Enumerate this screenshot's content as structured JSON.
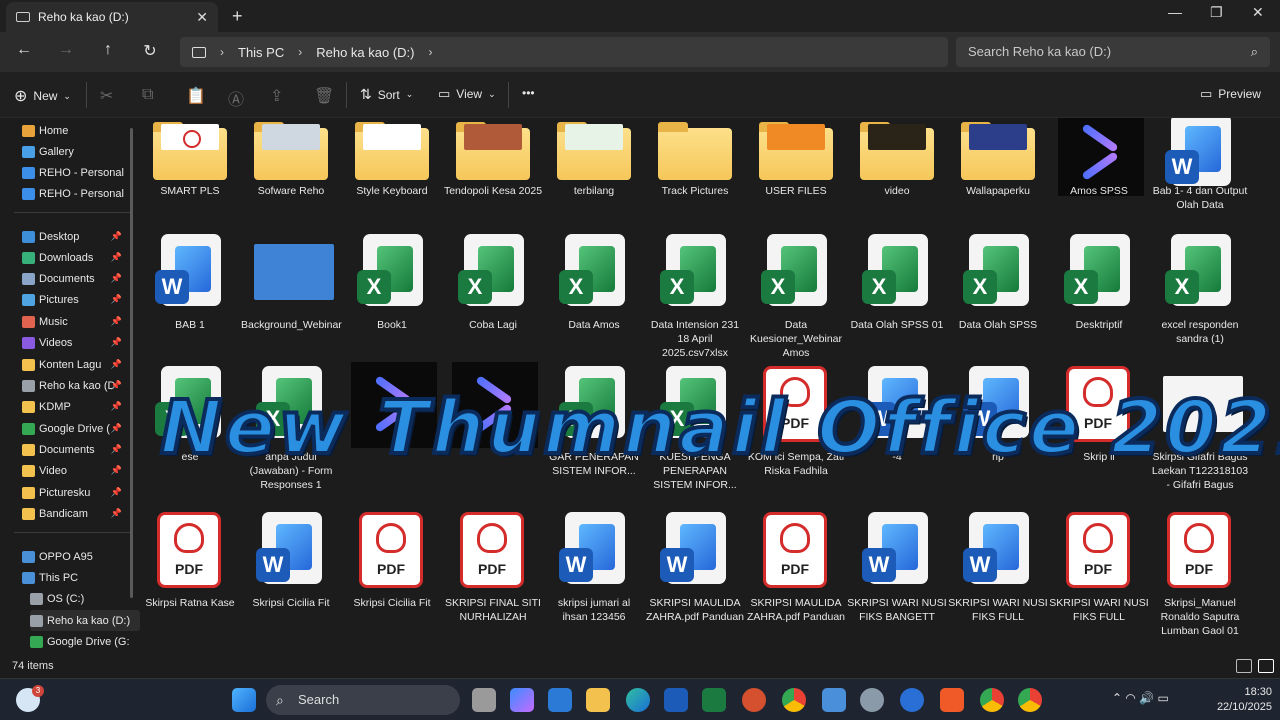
{
  "window": {
    "tab_title": "Reho ka kao (D:)",
    "new_tab": "+",
    "minimize": "—",
    "maximize": "❐",
    "close": "✕"
  },
  "nav": {
    "back": "←",
    "forward": "→",
    "up": "↑",
    "refresh": "↻",
    "breadcrumb": [
      "This PC",
      "Reho ka kao (D:)"
    ],
    "chevron": "›",
    "search_placeholder": "Search Reho ka kao (D:)"
  },
  "toolbar": {
    "new_label": "New",
    "sort_label": "Sort",
    "view_label": "View",
    "more": "•••",
    "preview_label": "Preview"
  },
  "sidebar": {
    "items": [
      {
        "label": "Home",
        "icon": "home-icon",
        "color": "#e8a33a",
        "pinned": false
      },
      {
        "label": "Gallery",
        "icon": "gallery-icon",
        "color": "#4aa0e6",
        "pinned": false
      },
      {
        "label": "REHO - Personal",
        "icon": "cloud-icon",
        "color": "#3b8fe8",
        "pinned": false
      },
      {
        "label": "REHO - Personal",
        "icon": "cloud-icon",
        "color": "#3b8fe8",
        "pinned": false
      },
      {
        "label": "Desktop",
        "icon": "desktop-icon",
        "color": "#3d8fd9",
        "pinned": true
      },
      {
        "label": "Downloads",
        "icon": "download-icon",
        "color": "#38b07a",
        "pinned": true
      },
      {
        "label": "Documents",
        "icon": "documents-icon",
        "color": "#8aa4c8",
        "pinned": true
      },
      {
        "label": "Pictures",
        "icon": "pictures-icon",
        "color": "#4fa3e0",
        "pinned": true
      },
      {
        "label": "Music",
        "icon": "music-icon",
        "color": "#e0634f",
        "pinned": true
      },
      {
        "label": "Videos",
        "icon": "videos-icon",
        "color": "#8a5be0",
        "pinned": true
      },
      {
        "label": "Konten Lagu",
        "icon": "folder-icon",
        "color": "#f2c14e",
        "pinned": true
      },
      {
        "label": "Reho ka kao (D",
        "icon": "drive-icon",
        "color": "#9aa0a8",
        "pinned": true
      },
      {
        "label": "KDMP",
        "icon": "folder-icon",
        "color": "#f2c14e",
        "pinned": true
      },
      {
        "label": "Google Drive (",
        "icon": "google-drive-icon",
        "color": "#34a853",
        "pinned": true
      },
      {
        "label": "Documents",
        "icon": "folder-icon",
        "color": "#f2c14e",
        "pinned": true
      },
      {
        "label": "Video",
        "icon": "folder-icon",
        "color": "#f2c14e",
        "pinned": true
      },
      {
        "label": "Picturesku",
        "icon": "folder-icon",
        "color": "#f2c14e",
        "pinned": true
      },
      {
        "label": "Bandicam",
        "icon": "folder-icon",
        "color": "#f2c14e",
        "pinned": true
      }
    ],
    "devices": [
      {
        "label": "OPPO A95",
        "icon": "phone-icon",
        "color": "#4a90d9"
      },
      {
        "label": "This PC",
        "icon": "pc-icon",
        "color": "#4a90d9"
      },
      {
        "label": "OS (C:)",
        "icon": "drive-icon",
        "color": "#9aa0a8"
      },
      {
        "label": "Reho ka kao (D:)",
        "icon": "drive-icon",
        "color": "#9aa0a8"
      },
      {
        "label": "Google Drive (G:",
        "icon": "google-drive-icon",
        "color": "#34a853"
      }
    ],
    "pin_glyph": "📌"
  },
  "files": {
    "row1": [
      {
        "name": "SMART PLS",
        "type": "folder",
        "peek": "pdf"
      },
      {
        "name": "Sofware Reho",
        "type": "folder",
        "peek": "#cfd8e0"
      },
      {
        "name": "Style Keyboard",
        "type": "folder",
        "peek": "#ffffff"
      },
      {
        "name": "Tendopoli Kesa 2025",
        "type": "folder",
        "peek": "#b05a3a"
      },
      {
        "name": "terbilang",
        "type": "folder",
        "peek": "#e8f3e8"
      },
      {
        "name": "Track Pictures",
        "type": "folder",
        "peek": ""
      },
      {
        "name": "USER FILES",
        "type": "folder",
        "peek": "#f08a24"
      },
      {
        "name": "video",
        "type": "folder",
        "peek": "#2a2418"
      },
      {
        "name": "Wallapaperku",
        "type": "folder",
        "peek": "#2c3d8a"
      },
      {
        "name": "Amos SPSS",
        "type": "amos"
      },
      {
        "name": "Bab 1- 4 dan Output Olah Data",
        "type": "word"
      }
    ],
    "row2": [
      {
        "name": "BAB 1",
        "type": "word"
      },
      {
        "name": "Background_Webinar",
        "type": "image",
        "color": "#3e83d6"
      },
      {
        "name": "Book1",
        "type": "excel"
      },
      {
        "name": "Coba Lagi",
        "type": "excel"
      },
      {
        "name": "Data Amos",
        "type": "excel"
      },
      {
        "name": "Data Intension 231 18 April 2025.csv7xlsx",
        "type": "excel"
      },
      {
        "name": "Data Kuesioner_Webinar Amos",
        "type": "excel"
      },
      {
        "name": "Data Olah SPSS 01",
        "type": "excel"
      },
      {
        "name": "Data Olah SPSS",
        "type": "excel"
      },
      {
        "name": "Desktriptif",
        "type": "excel"
      },
      {
        "name": "excel responden sandra (1)",
        "type": "excel"
      }
    ],
    "row3": [
      {
        "name": "ese",
        "type": "excel"
      },
      {
        "name": "anpa Judul (Jawaban) - Form Responses 1",
        "type": "excel"
      },
      {
        "name": "",
        "type": "amos"
      },
      {
        "name": "",
        "type": "amos"
      },
      {
        "name": "GAR PENERAPAN SISTEM INFOR...",
        "type": "excel"
      },
      {
        "name": "KUESI PENGA PENERAPAN SISTEM INFOR...",
        "type": "excel"
      },
      {
        "name": "KOM ici Sempa, Zati Riska Fadhila",
        "type": "pdf"
      },
      {
        "name": "-4",
        "type": "word"
      },
      {
        "name": "rip",
        "type": "word"
      },
      {
        "name": "Skrip il",
        "type": "pdf"
      },
      {
        "name": "Skirpsi Gifafri Bagus Laekan T122318103 - Gifafri Bagus",
        "type": "image",
        "color": "#f4f4f4"
      }
    ],
    "row4": [
      {
        "name": "Skirpsi Ratna Kase",
        "type": "pdf"
      },
      {
        "name": "Skripsi Cicilia Fit",
        "type": "word"
      },
      {
        "name": "Skripsi Cicilia Fit",
        "type": "pdf"
      },
      {
        "name": "SKRIPSI FINAL SITI NURHALIZAH",
        "type": "pdf"
      },
      {
        "name": "skripsi jumari al ihsan 123456",
        "type": "word"
      },
      {
        "name": "SKRIPSI MAULIDA ZAHRA.pdf Panduan",
        "type": "word"
      },
      {
        "name": "SKRIPSI MAULIDA ZAHRA.pdf Panduan",
        "type": "pdf"
      },
      {
        "name": "SKRIPSI WARI NUSI FIKS BANGETT",
        "type": "word"
      },
      {
        "name": "SKRIPSI WARI NUSI FIKS FULL",
        "type": "word"
      },
      {
        "name": "SKRIPSI WARI NUSI FIKS FULL",
        "type": "pdf"
      },
      {
        "name": "Skripsi_Manuel Ronaldo Saputra Lumban Gaol 01",
        "type": "pdf"
      }
    ],
    "pdf_text": "PDF",
    "word_letter": "W",
    "excel_letter": "X"
  },
  "overlay": {
    "text": "New Thumnail Office 2021"
  },
  "status": {
    "item_count": "74 items"
  },
  "taskbar": {
    "search_label": "Search",
    "time": "18:30",
    "date": "22/10/2025",
    "notification_count": "3",
    "tray_glyphs": "⌃  ◠  🔊  ▭"
  }
}
